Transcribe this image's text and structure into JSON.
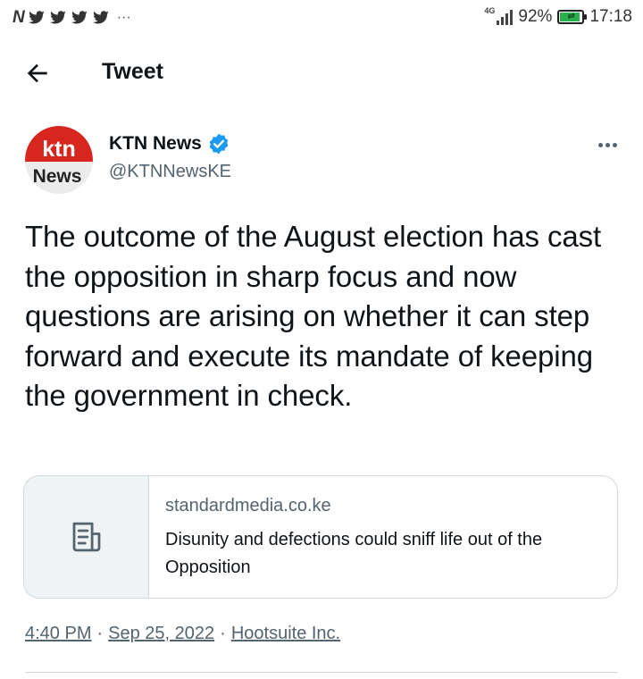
{
  "status_bar": {
    "network": "4G",
    "battery_percent": "92%",
    "battery_level": 0.92,
    "time": "17:18",
    "notification_icons": [
      "notification-icon",
      "twitter-icon",
      "twitter-icon",
      "twitter-icon",
      "twitter-icon"
    ],
    "overflow": "···"
  },
  "header": {
    "title": "Tweet"
  },
  "author": {
    "name": "KTN News",
    "handle": "@KTNNewsKE",
    "avatar_text_top": "ktn",
    "avatar_text_bottom": "News",
    "verified": true
  },
  "tweet": {
    "text": "The outcome of the August election has cast the opposition in sharp focus and now questions are arising on whether it can step forward and execute its mandate of keeping the government in check."
  },
  "link_card": {
    "domain": "standardmedia.co.ke",
    "title": "Disunity and defections could sniff life out of the Opposition"
  },
  "meta": {
    "time": "4:40 PM",
    "date": "Sep 25, 2022",
    "source": "Hootsuite Inc.",
    "separator": "·"
  },
  "colors": {
    "text_primary": "#0f1419",
    "text_secondary": "#536471",
    "verified_blue": "#1d9bf0",
    "ktn_red": "#d7261e",
    "border": "#cfd9de"
  }
}
